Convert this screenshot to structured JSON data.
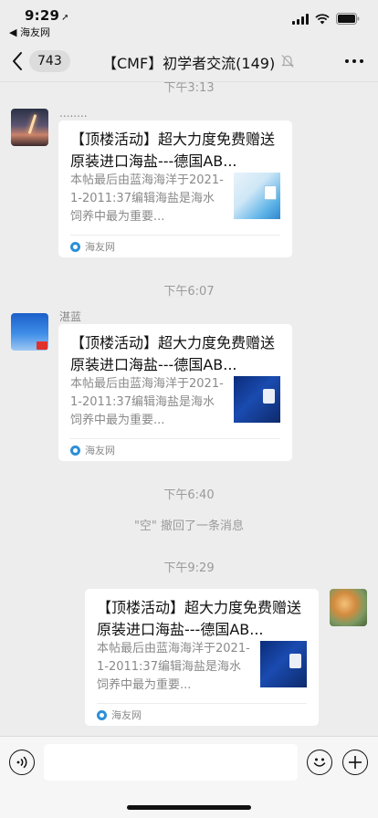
{
  "status": {
    "time": "9:29",
    "back_app": "◀ 海友网"
  },
  "nav": {
    "unread_count": "743",
    "title": "【CMF】初学者交流(149)"
  },
  "chat": {
    "partial_timestamp": "下午3:13",
    "messages": [
      {
        "sender": "........",
        "title": "【顶楼活动】超大力度免费赠送原装进口海盐---德国AB...",
        "desc": "本帖最后由蓝海海洋于2021-1-2011:37编辑海盐是海水饲养中最为重要...",
        "source": "海友网"
      },
      {
        "timestamp": "下午6:07",
        "sender": "湛蓝",
        "title": "【顶楼活动】超大力度免费赠送原装进口海盐---德国AB...",
        "desc": "本帖最后由蓝海海洋于2021-1-2011:37编辑海盐是海水饲养中最为重要...",
        "source": "海友网"
      },
      {
        "timestamp": "下午9:29",
        "title": "【顶楼活动】超大力度免费赠送原装进口海盐---德国AB...",
        "desc": "本帖最后由蓝海海洋于2021-1-2011:37编辑海盐是海水饲养中最为重要...",
        "source": "海友网"
      }
    ],
    "recall_timestamp": "下午6:40",
    "recall_notice": "\"空\" 撤回了一条消息"
  },
  "icons": {
    "back": "chevron-left-icon",
    "mute": "bell-off-icon",
    "more": "more-dots-icon",
    "voice": "voice-icon",
    "emoji": "emoji-icon",
    "plus": "plus-icon"
  }
}
